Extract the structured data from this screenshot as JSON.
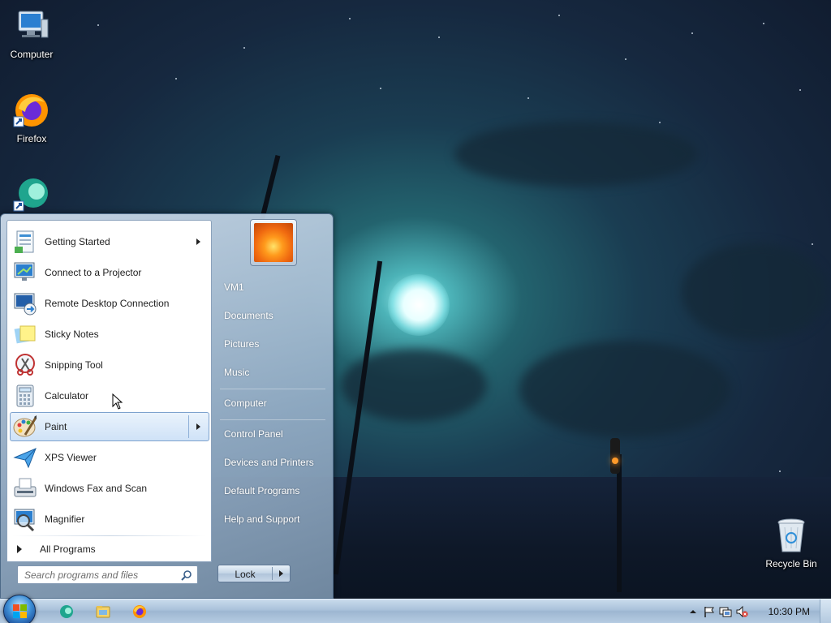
{
  "desktop": {
    "icons": [
      {
        "label": "Computer",
        "icon": "computer-icon"
      },
      {
        "label": "Firefox",
        "icon": "firefox-icon"
      },
      {
        "label": "",
        "icon": "app-shortcut-icon"
      },
      {
        "label": "Recycle Bin",
        "icon": "recycle-bin-icon"
      }
    ]
  },
  "start_menu": {
    "programs": [
      {
        "label": "Getting Started",
        "icon": "getting-started-icon",
        "has_submenu": true,
        "selected": false
      },
      {
        "label": "Connect to a Projector",
        "icon": "projector-icon",
        "has_submenu": false,
        "selected": false
      },
      {
        "label": "Remote Desktop Connection",
        "icon": "remote-desktop-icon",
        "has_submenu": false,
        "selected": false
      },
      {
        "label": "Sticky Notes",
        "icon": "sticky-notes-icon",
        "has_submenu": false,
        "selected": false
      },
      {
        "label": "Snipping Tool",
        "icon": "snipping-tool-icon",
        "has_submenu": false,
        "selected": false
      },
      {
        "label": "Calculator",
        "icon": "calculator-icon",
        "has_submenu": false,
        "selected": false
      },
      {
        "label": "Paint",
        "icon": "paint-icon",
        "has_submenu": true,
        "selected": true
      },
      {
        "label": "XPS Viewer",
        "icon": "xps-viewer-icon",
        "has_submenu": false,
        "selected": false
      },
      {
        "label": "Windows Fax and Scan",
        "icon": "fax-scan-icon",
        "has_submenu": false,
        "selected": false
      },
      {
        "label": "Magnifier",
        "icon": "magnifier-icon",
        "has_submenu": false,
        "selected": false
      }
    ],
    "all_programs": "All Programs",
    "search_placeholder": "Search programs and files",
    "user_links": [
      {
        "label": "VM1"
      },
      {
        "label": "Documents"
      },
      {
        "label": "Pictures"
      },
      {
        "label": "Music"
      },
      {
        "label": "Computer"
      },
      {
        "label": "Control Panel"
      },
      {
        "label": "Devices and Printers"
      },
      {
        "label": "Default Programs"
      },
      {
        "label": "Help and Support"
      }
    ],
    "lock_label": "Lock"
  },
  "taskbar": {
    "pinned": [
      {
        "icon": "app-shortcut-icon"
      },
      {
        "icon": "file-explorer-icon"
      },
      {
        "icon": "firefox-icon"
      }
    ],
    "tray_icons": [
      "show-hidden-icons-icon",
      "action-center-flag-icon",
      "network-icon",
      "volume-muted-icon"
    ],
    "clock": "10:30 PM"
  },
  "colors": {
    "selection_bg": "#cfe2f7",
    "selection_border": "#7da2ce",
    "accent": "#3e8fd6"
  }
}
